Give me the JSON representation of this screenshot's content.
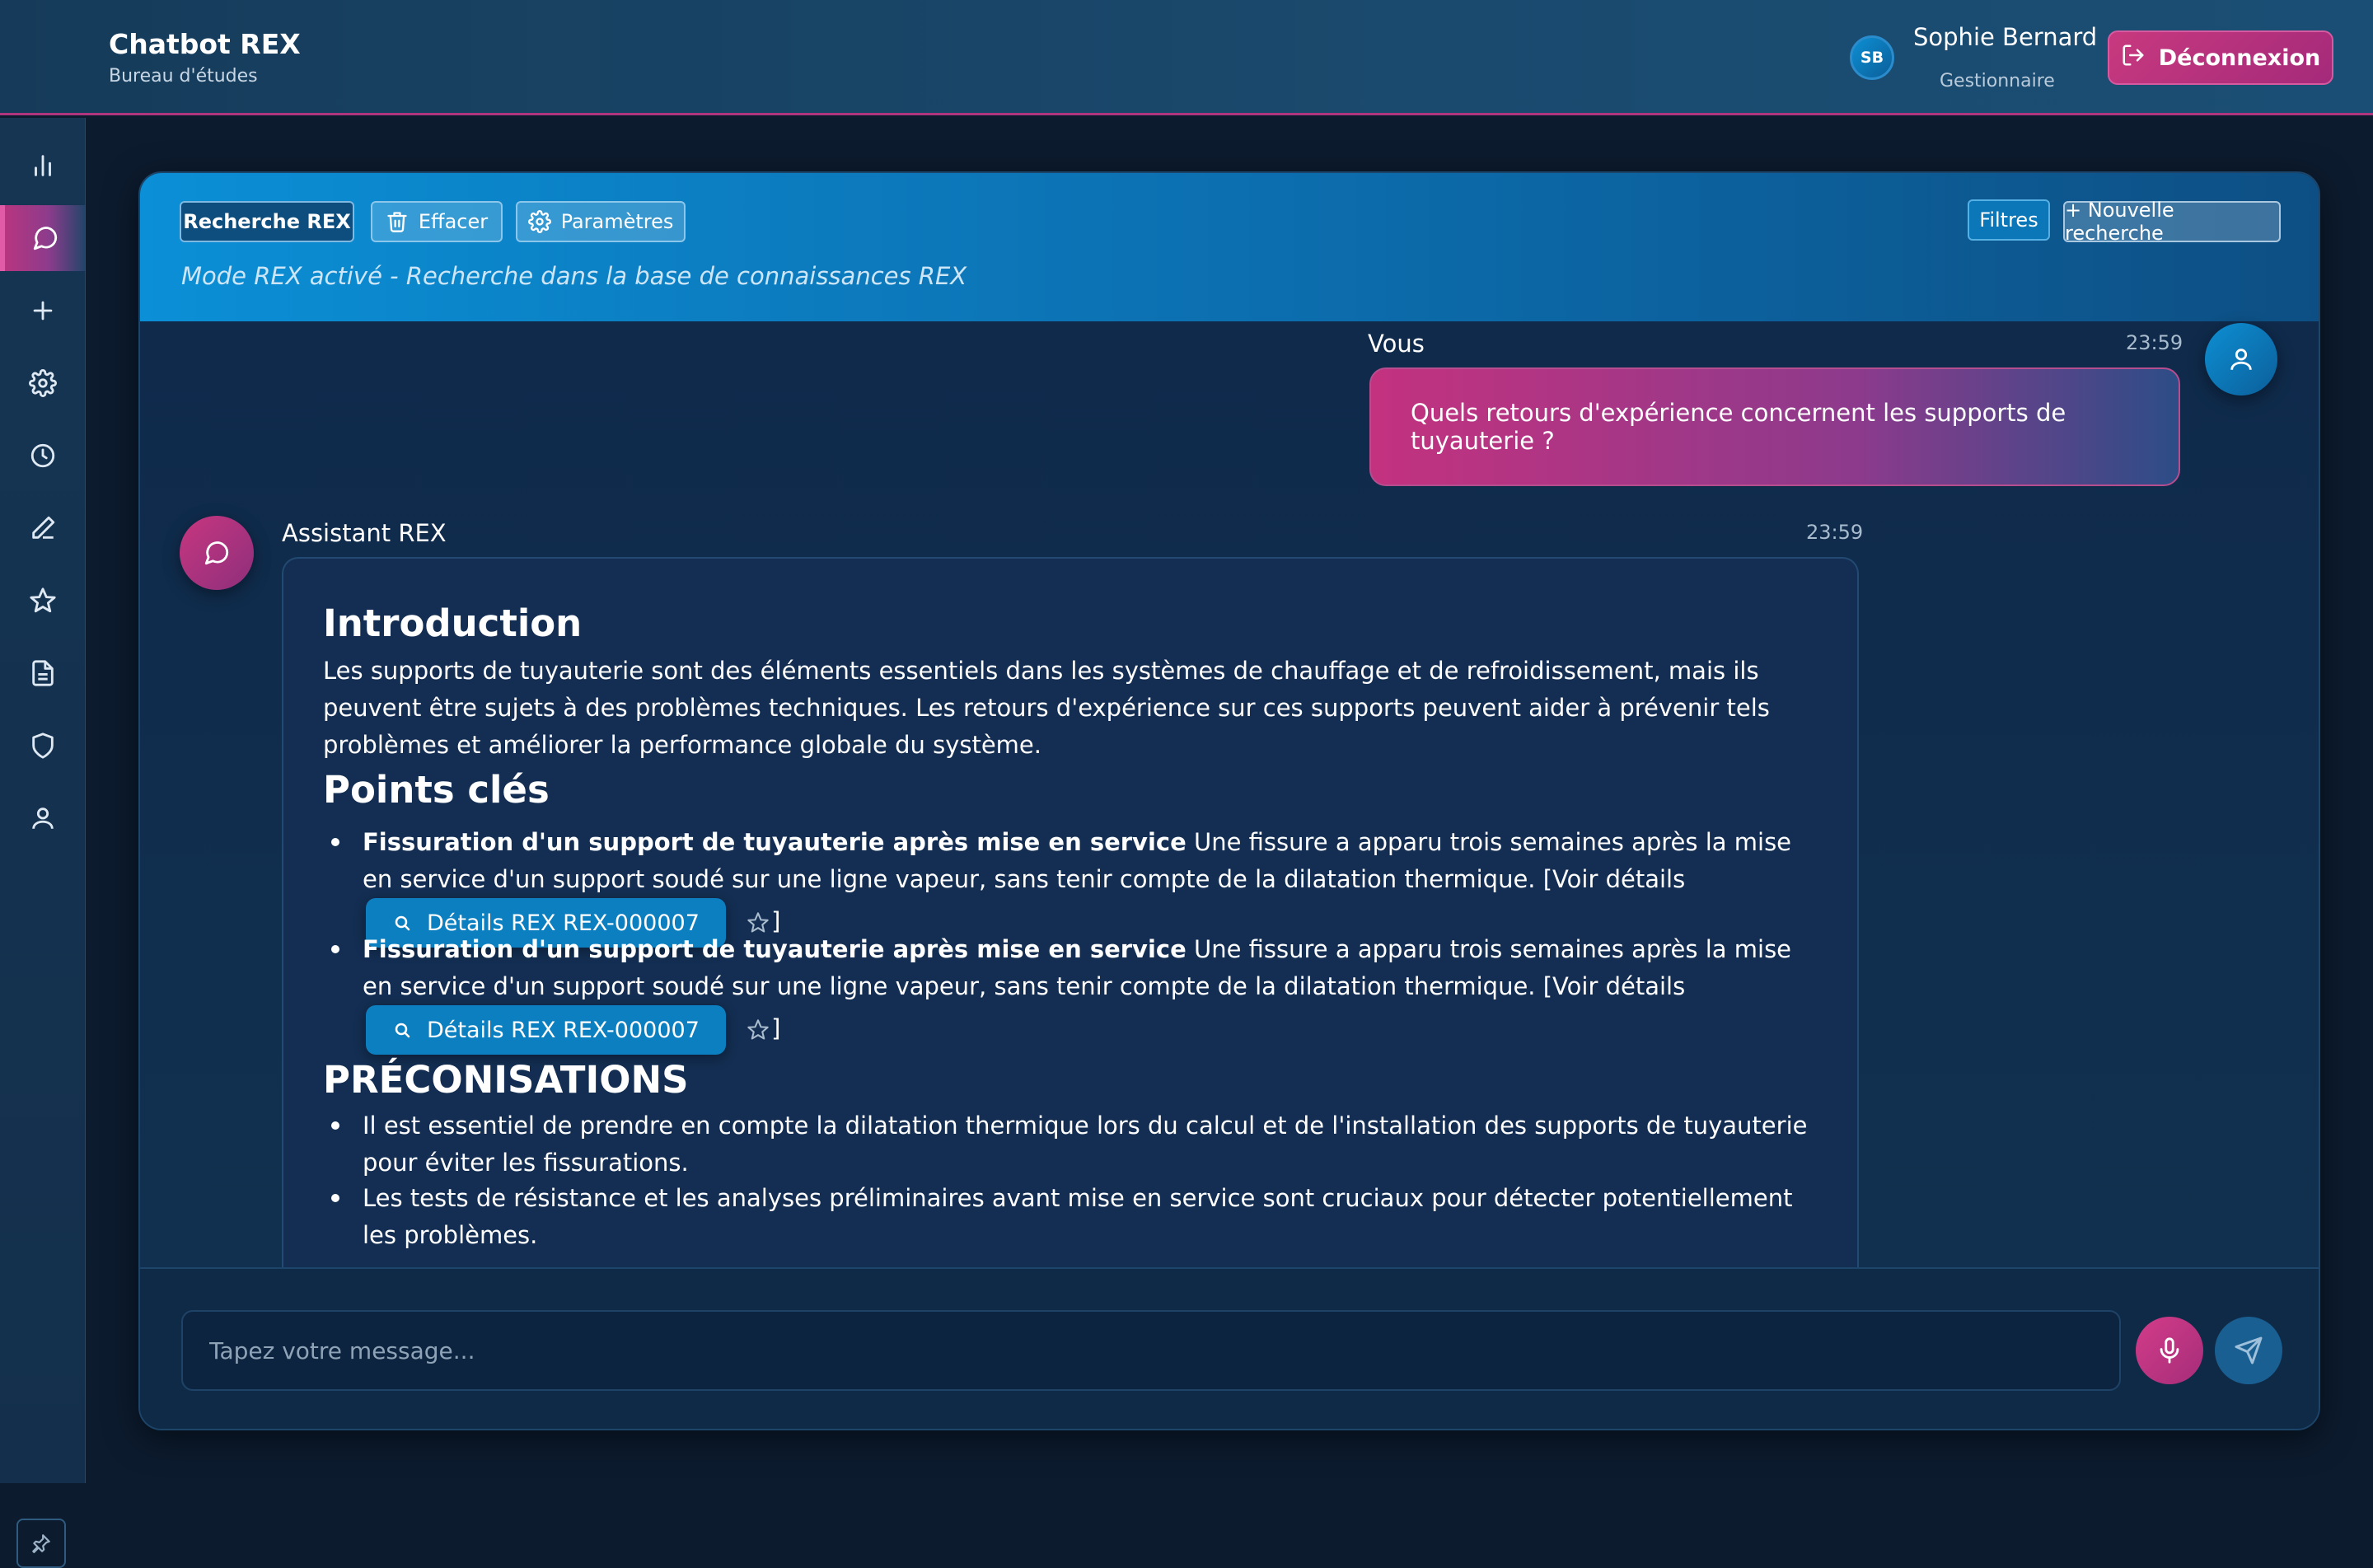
{
  "app": {
    "title": "Chatbot REX",
    "subtitle": "Bureau d'études"
  },
  "user": {
    "initials": "SB",
    "name": "Sophie Bernard",
    "role": "Gestionnaire",
    "logout_label": "Déconnexion"
  },
  "sidebar": {
    "items": [
      {
        "icon": "bar-chart-icon",
        "active": false
      },
      {
        "icon": "chat-bubble-icon",
        "active": true
      },
      {
        "icon": "plus-icon",
        "active": false
      },
      {
        "icon": "gear-icon",
        "active": false
      },
      {
        "icon": "clock-icon",
        "active": false
      },
      {
        "icon": "pencil-icon",
        "active": false
      },
      {
        "icon": "star-icon",
        "active": false
      },
      {
        "icon": "document-icon",
        "active": false
      },
      {
        "icon": "shield-icon",
        "active": false
      },
      {
        "icon": "user-icon",
        "active": false
      }
    ],
    "pin_icon": "pin-icon"
  },
  "toolbar": {
    "search_rex_label": "Recherche REX",
    "clear_label": "Effacer",
    "settings_label": "Paramètres",
    "filters_label": "Filtres",
    "new_search_label": "+ Nouvelle recherche",
    "mode_text": "Mode REX activé - Recherche dans la base de connaissances REX"
  },
  "conversation": {
    "user_message": {
      "author": "Vous",
      "time": "23:59",
      "text": "Quels retours d'expérience concernent les supports de tuyauterie ?"
    },
    "bot_message": {
      "author": "Assistant REX",
      "time": "23:59",
      "intro_heading": "Introduction",
      "intro_text": "Les supports de tuyauterie sont des éléments essentiels dans les systèmes de chauffage et de refroidissement, mais ils peuvent être sujets à des problèmes techniques. Les retours d'expérience sur ces supports peuvent aider à prévenir tels problèmes et améliorer la performance globale du système.",
      "key_points_heading": "Points clés",
      "key_points": [
        {
          "title": "Fissuration d'un support de tuyauterie après mise en service",
          "text": " Une fissure a apparu trois semaines après la mise en service d'un support soudé sur une ligne vapeur, sans tenir compte de la dilatation thermique. [Voir détails",
          "button_label": "Détails REX REX-000007",
          "closing": "]"
        },
        {
          "title": "Fissuration d'un support de tuyauterie après mise en service",
          "text": " Une fissure a apparu trois semaines après la mise en service d'un support soudé sur une ligne vapeur, sans tenir compte de la dilatation thermique. [Voir détails",
          "button_label": "Détails REX REX-000007",
          "closing": "]"
        }
      ],
      "recommendations_heading": "PRÉCONISATIONS",
      "recommendations": [
        "Il est essentiel de prendre en compte la dilatation thermique lors du calcul et de l'installation des supports de tuyauterie pour éviter les fissurations.",
        "Les tests de résistance et les analyses préliminaires avant mise en service sont cruciaux pour détecter potentiellement les problèmes."
      ]
    }
  },
  "composer": {
    "placeholder": "Tapez votre message...",
    "value": ""
  },
  "colors": {
    "accent_pink": "#c3327f",
    "accent_blue": "#0b8fd6",
    "background": "#0c1b2e"
  }
}
